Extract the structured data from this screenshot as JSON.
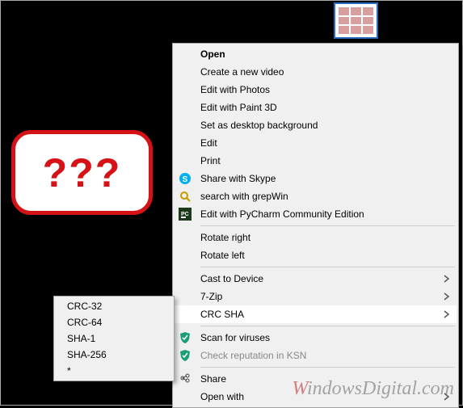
{
  "bubble_text": "???",
  "menu": {
    "open": "Open",
    "create_video": "Create a new video",
    "edit_photos": "Edit with Photos",
    "edit_paint3d": "Edit with Paint 3D",
    "set_background": "Set as desktop background",
    "edit": "Edit",
    "print": "Print",
    "share_skype": "Share with Skype",
    "search_grepwin": "search with grepWin",
    "edit_pycharm": "Edit with PyCharm Community Edition",
    "rotate_right": "Rotate right",
    "rotate_left": "Rotate left",
    "cast_device": "Cast to Device",
    "seven_zip": "7-Zip",
    "crc_sha": "CRC SHA",
    "scan_viruses": "Scan for viruses",
    "check_ksn": "Check reputation in KSN",
    "share": "Share",
    "open_with": "Open with"
  },
  "submenu": {
    "crc32": "CRC-32",
    "crc64": "CRC-64",
    "sha1": "SHA-1",
    "sha256": "SHA-256",
    "star": "*"
  },
  "watermark": {
    "w": "W",
    "rest": "indowsDigital.com"
  }
}
